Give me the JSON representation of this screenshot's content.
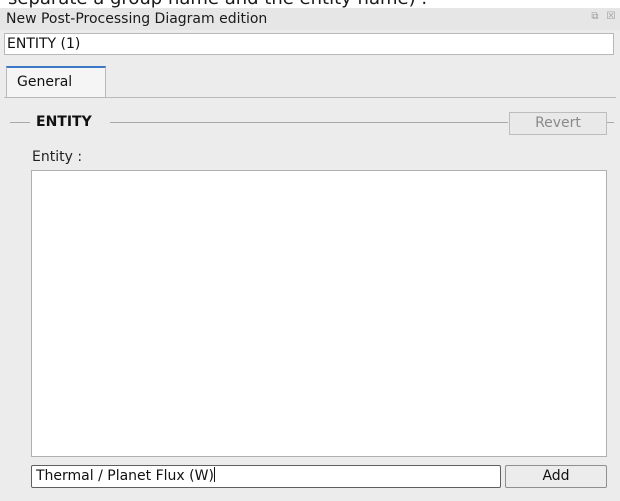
{
  "background_caption": "separate a group name and the entity name) .",
  "window": {
    "title": "New Post-Processing Diagram edition",
    "buttons": [
      {
        "icon": "float-icon",
        "glyph": "⧉"
      },
      {
        "icon": "close-icon",
        "glyph": "☒"
      }
    ]
  },
  "entity_title": "ENTITY (1)",
  "tabs": [
    {
      "label": "General",
      "active": true
    }
  ],
  "group": {
    "title": "ENTITY",
    "revert_label": "Revert",
    "entity_label": "Entity :",
    "list_items": [],
    "input_value": "Thermal / Planet Flux (W)",
    "add_label": "Add"
  },
  "colors": {
    "panel": "#ececec",
    "active_tab_accent": "#3b78c6",
    "disabled_text": "#8a8a8a"
  }
}
